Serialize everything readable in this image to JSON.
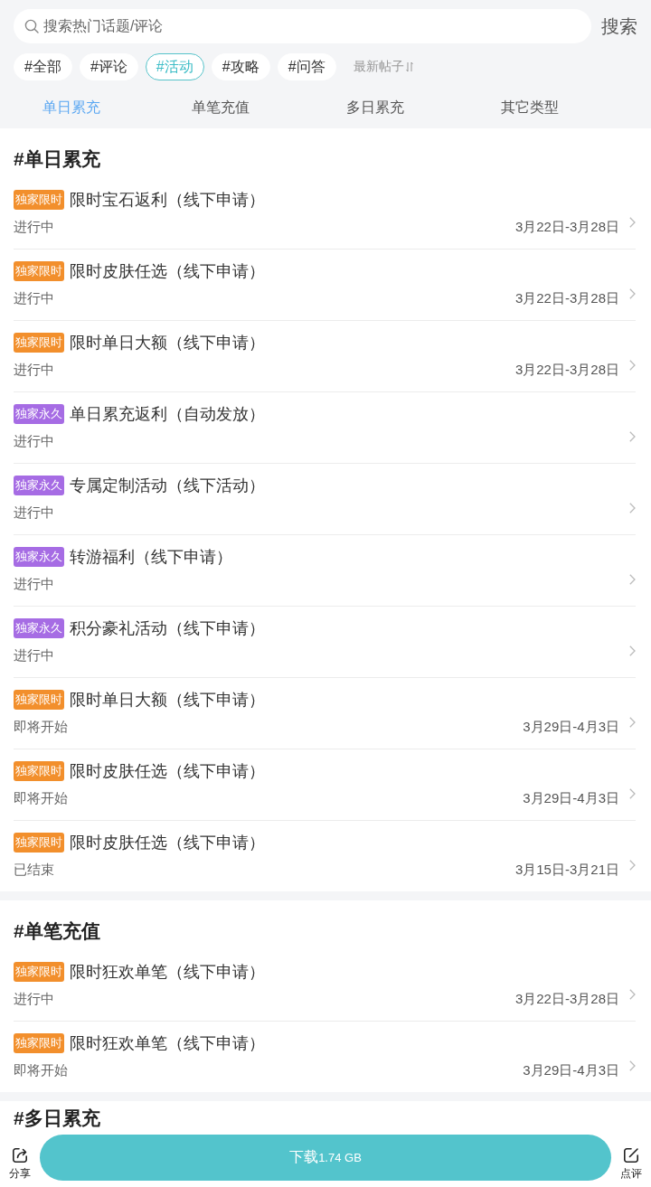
{
  "search": {
    "placeholder": "搜索热门话题/评论",
    "button": "搜索"
  },
  "topics": [
    {
      "label": "#全部",
      "selected": false
    },
    {
      "label": "#评论",
      "selected": false
    },
    {
      "label": "#活动",
      "selected": true
    },
    {
      "label": "#攻略",
      "selected": false
    },
    {
      "label": "#问答",
      "selected": false
    }
  ],
  "sort": {
    "label": "最新帖子"
  },
  "tabs": [
    {
      "label": "单日累充",
      "selected": true
    },
    {
      "label": "单笔充值",
      "selected": false
    },
    {
      "label": "多日累充",
      "selected": false
    },
    {
      "label": "其它类型",
      "selected": false
    }
  ],
  "sections": [
    {
      "title": "#单日累充",
      "items": [
        {
          "tag": {
            "text": "独家限时",
            "color": "#f28f2c"
          },
          "title": "限时宝石返利（线下申请）",
          "status": "进行中",
          "date": "3月22日-3月28日"
        },
        {
          "tag": {
            "text": "独家限时",
            "color": "#f28f2c"
          },
          "title": "限时皮肤任选（线下申请）",
          "status": "进行中",
          "date": "3月22日-3月28日"
        },
        {
          "tag": {
            "text": "独家限时",
            "color": "#f28f2c"
          },
          "title": "限时单日大额（线下申请）",
          "status": "进行中",
          "date": "3月22日-3月28日"
        },
        {
          "tag": {
            "text": "独家永久",
            "color": "#a66ce4"
          },
          "title": "单日累充返利（自动发放）",
          "status": "进行中"
        },
        {
          "tag": {
            "text": "独家永久",
            "color": "#a66ce4"
          },
          "title": "专属定制活动（线下活动）",
          "status": "进行中"
        },
        {
          "tag": {
            "text": "独家永久",
            "color": "#a66ce4"
          },
          "title": "转游福利（线下申请）",
          "status": "进行中"
        },
        {
          "tag": {
            "text": "独家永久",
            "color": "#a66ce4"
          },
          "title": "积分豪礼活动（线下申请）",
          "status": "进行中"
        },
        {
          "tag": {
            "text": "独家限时",
            "color": "#f28f2c"
          },
          "title": "限时单日大额（线下申请）",
          "status": "即将开始",
          "date": "3月29日-4月3日"
        },
        {
          "tag": {
            "text": "独家限时",
            "color": "#f28f2c"
          },
          "title": "限时皮肤任选（线下申请）",
          "status": "即将开始",
          "date": "3月29日-4月3日"
        },
        {
          "tag": {
            "text": "独家限时",
            "color": "#f28f2c"
          },
          "title": "限时皮肤任选（线下申请）",
          "status": "已结束",
          "date": "3月15日-3月21日"
        }
      ]
    },
    {
      "title": "#单笔充值",
      "items": [
        {
          "tag": {
            "text": "独家限时",
            "color": "#f28f2c"
          },
          "title": "限时狂欢单笔（线下申请）",
          "status": "进行中",
          "date": "3月22日-3月28日"
        },
        {
          "tag": {
            "text": "独家限时",
            "color": "#f28f2c"
          },
          "title": "限时狂欢单笔（线下申请）",
          "status": "即将开始",
          "date": "3月29日-4月3日"
        }
      ]
    },
    {
      "title": "#多日累充"
    }
  ],
  "bottom_bar": {
    "share": "分享",
    "download": {
      "label": "下载",
      "size": "1.74 GB"
    },
    "review": "点评"
  }
}
